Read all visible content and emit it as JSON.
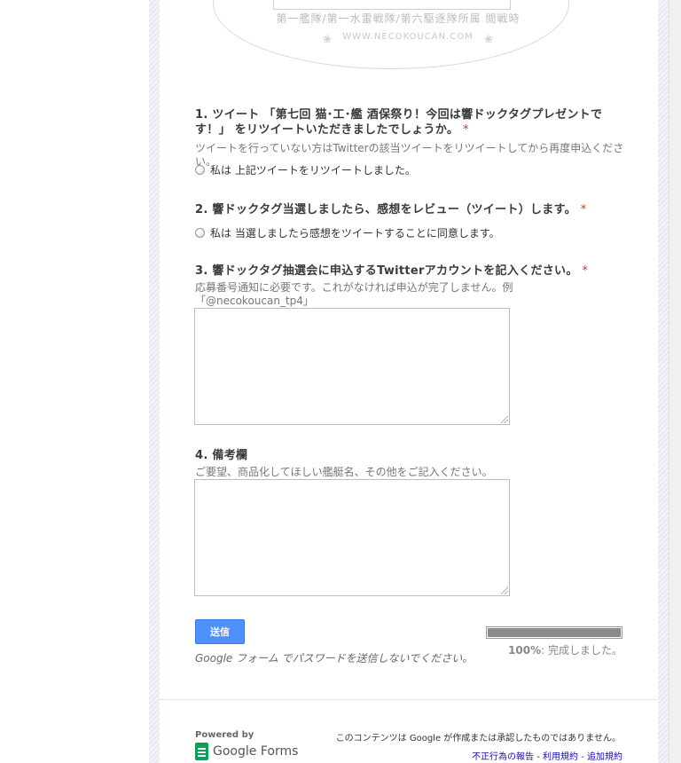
{
  "header_image": {
    "caption": "第一艦隊/第一水雷戦隊/第六駆逐隊所属 閲戦時",
    "url": "WWW.NECOKOUCAN.COM"
  },
  "questions": [
    {
      "title": "1. ツイート 「第七回 猫･工･艦 酒保祭り！今回は響ドックタグプレゼントです！」 をリツイートいただきましたでしょうか。",
      "required_mark": "*",
      "help": "ツイートを行っていない方はTwitterの該当ツイートをリツイートしてから再度申込ください。",
      "option": "私は 上記ツイートをリツイートしました。"
    },
    {
      "title": "2. 響ドックタグ当選しましたら、感想をレビュー（ツイート）します。",
      "required_mark": "*",
      "option": "私は 当選しましたら感想をツイートすることに同意します。"
    },
    {
      "title": "3. 響ドックタグ抽選会に申込するTwitterアカウントを記入ください。",
      "required_mark": "*",
      "help": "応募番号通知に必要です。これがなければ申込が完了しません。例「@necokoucan_tp4」",
      "value": ""
    },
    {
      "title": "4. 備考欄",
      "help": "ご要望、商品化してほしい艦艇名、その他をご記入ください。",
      "value": ""
    }
  ],
  "submit_label": "送信",
  "password_note": "Google フォーム でパスワードを送信しないでください。",
  "progress": {
    "percent_label": "100%",
    "status": ": 完成しました。",
    "fraction": 1.0
  },
  "footer": {
    "powered_by": "Powered by",
    "brand": "Google Forms",
    "disclaimer": "このコンテンツは Google が作成または承認したものではありません。",
    "links": [
      "不正行為の報告",
      "利用規約",
      "追加規約"
    ],
    "link_separator": " - "
  }
}
